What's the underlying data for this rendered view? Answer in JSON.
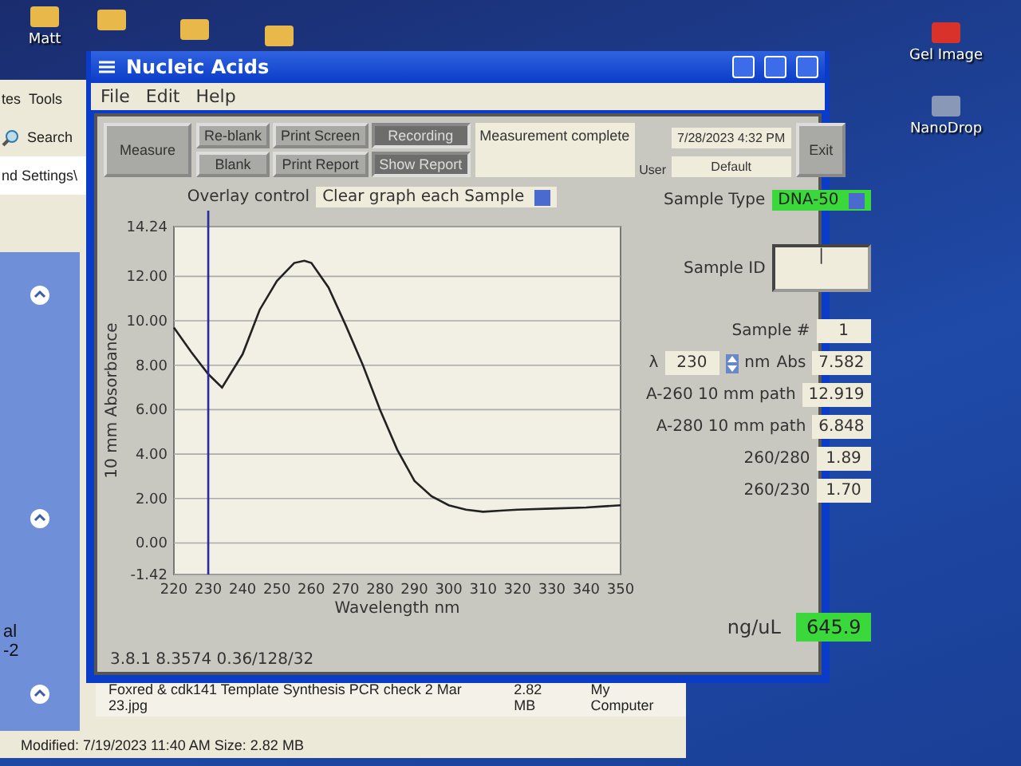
{
  "desktop": {
    "icons": [
      {
        "label": "Matt"
      },
      {
        "label": "Gel Image"
      },
      {
        "label": "NanoDrop"
      }
    ]
  },
  "background_window": {
    "menu": [
      "tes",
      "Tools"
    ],
    "search": "Search",
    "address": "nd Settings\\",
    "side_texts": [
      "al",
      "-2"
    ],
    "file_name": "Foxred & cdk141 Template Synthesis PCR check 2 Mar 23.jpg",
    "file_size": "2.82 MB",
    "zone": "My Computer",
    "details": "Modified: 7/19/2023 11:40 AM Size: 2.82 MB"
  },
  "window": {
    "title": "Nucleic Acids",
    "menu": [
      "File",
      "Edit",
      "Help"
    ],
    "measure": "Measure",
    "buttons": [
      {
        "label": "Re-blank",
        "pressed": false
      },
      {
        "label": "Print Screen",
        "pressed": false
      },
      {
        "label": "Recording",
        "pressed": true
      },
      {
        "label": "Blank",
        "pressed": false
      },
      {
        "label": "Print Report",
        "pressed": false
      },
      {
        "label": "Show Report",
        "pressed": true
      }
    ],
    "status": "Measurement complete",
    "date": "7/28/2023 4:32 PM",
    "user_label": "User",
    "user": "Default",
    "exit": "Exit",
    "overlay": {
      "label": "Overlay control",
      "value": "Clear graph each Sample"
    },
    "chart_data": {
      "type": "line",
      "xlabel": "Wavelength nm",
      "ylabel": "10 mm Absorbance",
      "x": [
        220,
        225,
        230,
        234,
        240,
        245,
        250,
        255,
        258,
        260,
        265,
        270,
        275,
        280,
        285,
        290,
        295,
        300,
        305,
        310,
        315,
        320,
        330,
        340,
        350
      ],
      "grid": true,
      "series": [
        {
          "color": "#222222",
          "values": [
            9.7,
            8.6,
            7.6,
            7.0,
            8.5,
            10.5,
            11.8,
            12.6,
            12.7,
            12.6,
            11.5,
            9.8,
            8.0,
            6.0,
            4.2,
            2.8,
            2.1,
            1.7,
            1.5,
            1.4,
            1.45,
            1.5,
            1.55,
            1.6,
            1.7
          ]
        }
      ],
      "xlim": [
        220,
        350
      ],
      "ylim": [
        -1.42,
        14.24
      ],
      "xticks": [
        220,
        230,
        240,
        250,
        260,
        270,
        280,
        290,
        300,
        310,
        320,
        330,
        340,
        350
      ],
      "yticks": [
        {
          "value": -1.42,
          "label": "-1.42"
        },
        {
          "value": 0,
          "label": "0.00"
        },
        {
          "value": 2,
          "label": "2.00"
        },
        {
          "value": 4,
          "label": "4.00"
        },
        {
          "value": 6,
          "label": "6.00"
        },
        {
          "value": 8,
          "label": "8.00"
        },
        {
          "value": 10,
          "label": "10.00"
        },
        {
          "value": 12,
          "label": "12.00"
        },
        {
          "value": 14.24,
          "label": "14.24"
        }
      ],
      "ref_lines": [
        {
          "axis": "x",
          "value": 230
        }
      ]
    },
    "sample_type": {
      "label": "Sample Type",
      "value": "DNA-50"
    },
    "sample_id": {
      "label": "Sample ID",
      "value": "|"
    },
    "sample_number": {
      "label": "Sample #",
      "value": "1"
    },
    "wavelength": {
      "label": "λ",
      "value": "230",
      "unit": "nm",
      "abs_label": "Abs",
      "abs_value": "7.582"
    },
    "readouts": [
      {
        "label": "A-260 10 mm path",
        "value": "12.919"
      },
      {
        "label": "A-280 10 mm path",
        "value": "6.848"
      },
      {
        "label": "260/280",
        "value": "1.89"
      },
      {
        "label": "260/230",
        "value": "1.70"
      }
    ],
    "concentration": {
      "unit": "ng/uL",
      "value": "645.9"
    },
    "status_bar": "3.8.1 8.3574 0.36/128/32"
  }
}
